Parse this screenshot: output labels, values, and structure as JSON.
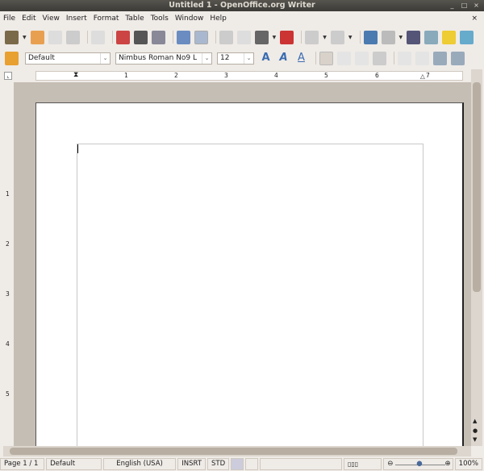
{
  "window": {
    "title": "Untitled 1 - OpenOffice.org Writer",
    "minimize": "_",
    "maximize": "□",
    "close": "×"
  },
  "menu": [
    "File",
    "Edit",
    "View",
    "Insert",
    "Format",
    "Table",
    "Tools",
    "Window",
    "Help"
  ],
  "menu_close": "×",
  "formatting": {
    "style": "Default",
    "font": "Nimbus Roman No9 L",
    "size": "12"
  },
  "ruler": {
    "numbers": [
      "1",
      "2",
      "3",
      "4",
      "5",
      "6",
      "7"
    ],
    "vnumbers": [
      "1",
      "2",
      "3",
      "4",
      "5"
    ]
  },
  "status": {
    "page": "Page 1 / 1",
    "style": "Default",
    "language": "English (USA)",
    "insert_mode": "INSRT",
    "selection_mode": "STD",
    "zoom": "100%"
  },
  "colors": {
    "titlebar": "#3c3b37",
    "chrome": "#efebe7",
    "doc_bg": "#c5beb4"
  }
}
